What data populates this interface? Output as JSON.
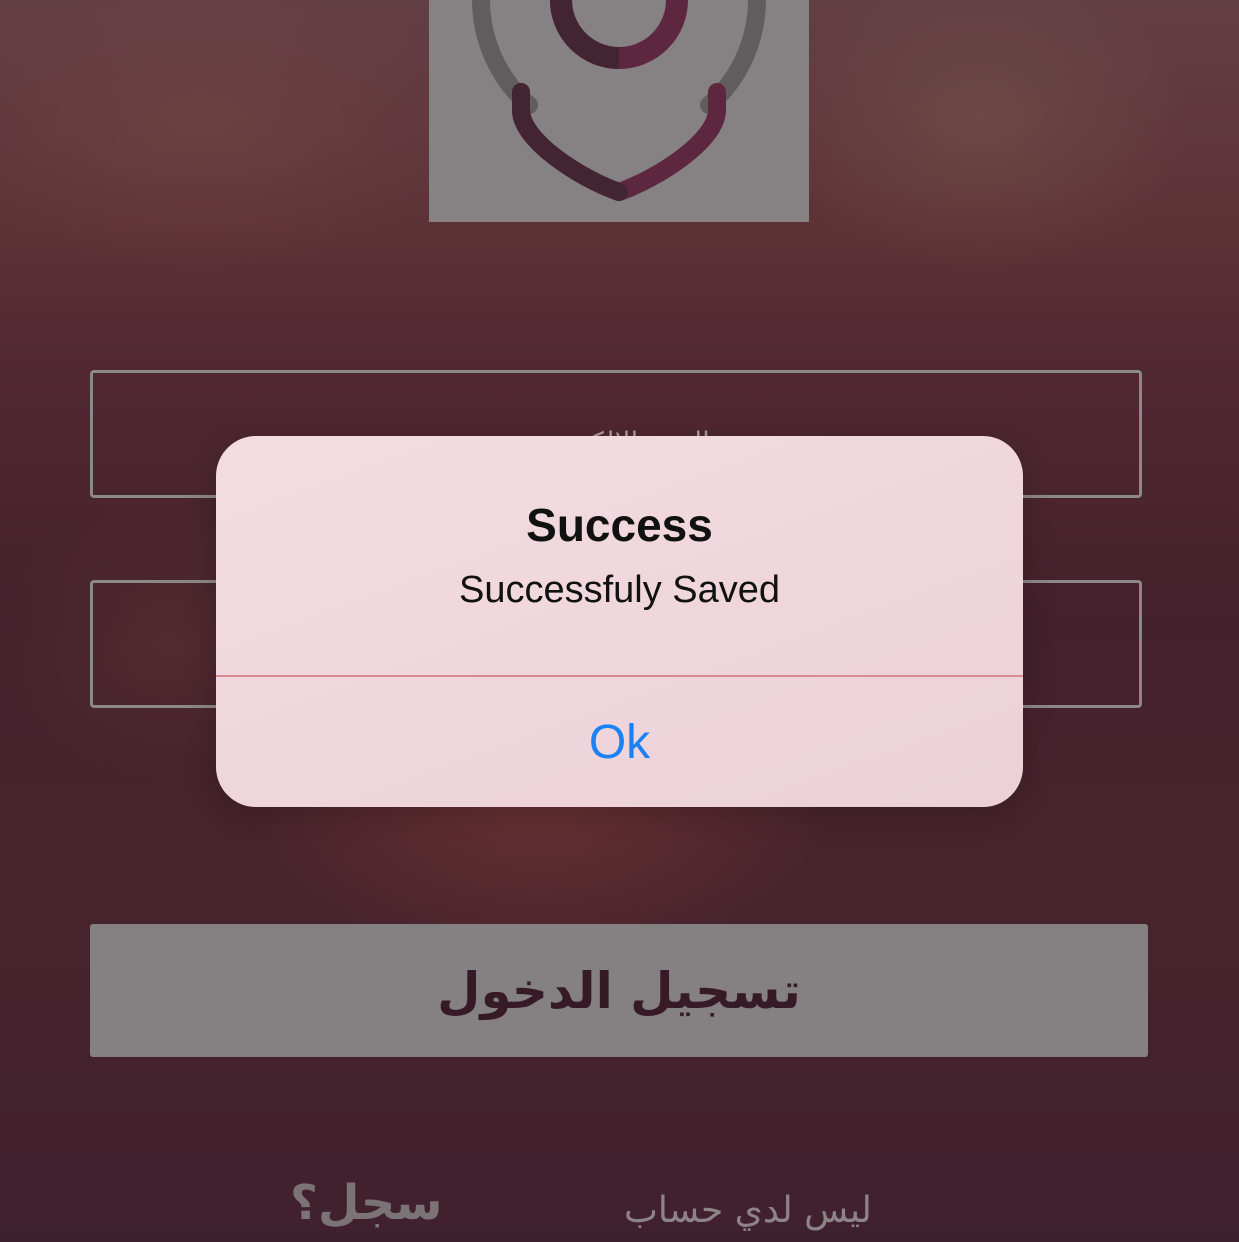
{
  "logo": {
    "icon": "location-pin-icon",
    "colors": {
      "box": "#9b9b9b",
      "pin_gray": "#6e6e6e",
      "pin_plum": "#6b2e4a",
      "pin_dark": "#4a2a3a"
    }
  },
  "form": {
    "email_placeholder": "البريد الالكتروني",
    "password_placeholder": "",
    "login_label": "تسجيل الدخول"
  },
  "footer": {
    "no_account_text": "ليس لدي حساب",
    "register_label": "سجل؟"
  },
  "alert": {
    "title": "Success",
    "message": "Successfuly Saved",
    "ok_label": "Ok",
    "ok_color": "#1a82f5"
  }
}
